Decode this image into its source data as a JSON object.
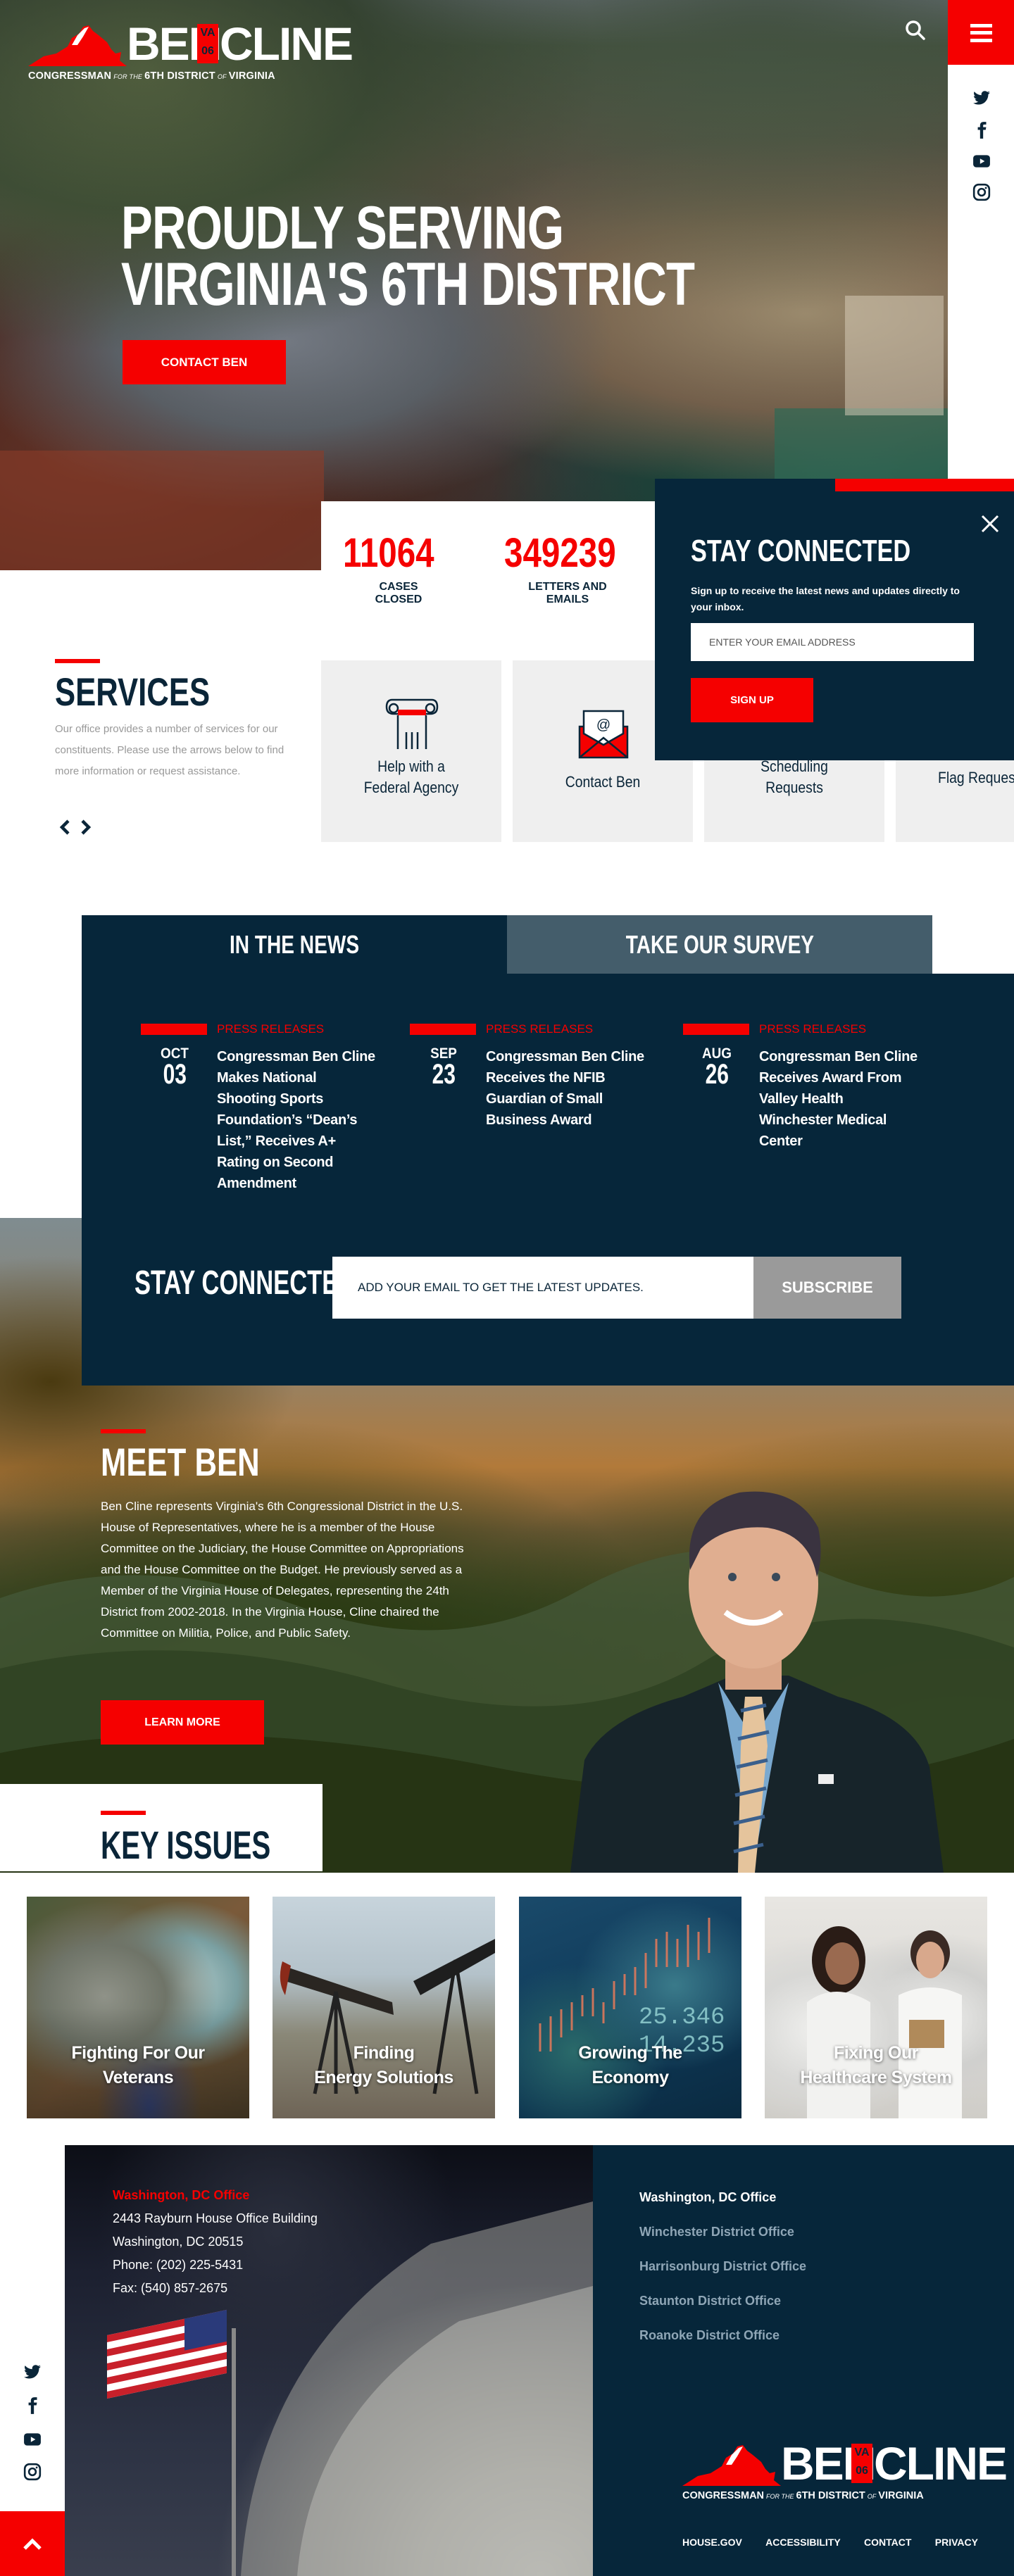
{
  "brand": {
    "first_name": "BEN",
    "badge_top": "VA",
    "badge_bottom": "06",
    "last_name": "CLINE",
    "tagline_1": "CONGRESSMAN",
    "tagline_2": "FOR THE",
    "tagline_3": "6TH DISTRICT",
    "tagline_4": "OF",
    "tagline_5": "VIRGINIA",
    "colors": {
      "red": "#f50000",
      "navy": "#06263a",
      "slate": "#445d6b",
      "grey": "#9a9a9a"
    }
  },
  "header": {
    "search_icon": "search-icon",
    "menu_icon": "hamburger-menu-icon",
    "social": [
      "twitter-icon",
      "facebook-icon",
      "youtube-icon",
      "instagram-icon"
    ]
  },
  "hero": {
    "title_line1": "PROUDLY SERVING",
    "title_line2": "VIRGINIA'S 6TH DISTRICT",
    "cta": "CONTACT BEN"
  },
  "stats": [
    {
      "value": "11064",
      "label_line1": "CASES",
      "label_line2": "CLOSED"
    },
    {
      "value": "349239",
      "label_line1": "LETTERS AND",
      "label_line2": "EMAILS"
    }
  ],
  "popup": {
    "title": "STAY CONNECTED",
    "text": "Sign up to receive the latest news and updates directly to your inbox.",
    "email_placeholder": "ENTER YOUR EMAIL ADDRESS",
    "button": "SIGN UP",
    "close_icon": "close-icon"
  },
  "services": {
    "title": "SERVICES",
    "description": "Our office provides a number of services for our constituents. Please use the arrows below to find more information or request assistance.",
    "items": [
      {
        "label_line1": "Help with a",
        "label_line2": "Federal Agency",
        "icon": "column-icon"
      },
      {
        "label_line1": "Contact Ben",
        "label_line2": "",
        "icon": "email-envelope-icon"
      },
      {
        "label_line1": "Scheduling",
        "label_line2": "Requests",
        "icon": "calendar-icon"
      },
      {
        "label_line1": "Flag Requests",
        "label_line2": "",
        "icon": "flag-icon"
      }
    ]
  },
  "news": {
    "tabs": [
      {
        "label": "IN THE NEWS",
        "active": true
      },
      {
        "label": "TAKE OUR SURVEY",
        "active": false
      }
    ],
    "articles": [
      {
        "category": "PRESS RELEASES",
        "month": "OCT",
        "day": "03",
        "title": "Congressman Ben Cline Makes National Shooting Sports Foundation’s “Dean’s List,” Receives A+ Rating on Second Amendment"
      },
      {
        "category": "PRESS RELEASES",
        "month": "SEP",
        "day": "23",
        "title": "Congressman Ben Cline Receives the NFIB Guardian of Small Business Award"
      },
      {
        "category": "PRESS RELEASES",
        "month": "AUG",
        "day": "26",
        "title": "Congressman Ben Cline Receives Award From Valley Health Winchester Medical Center"
      }
    ],
    "subscribe": {
      "title": "STAY CONNECTED",
      "placeholder": "ADD YOUR EMAIL TO GET THE LATEST UPDATES.",
      "button": "SUBSCRIBE"
    }
  },
  "meet": {
    "title": "MEET BEN",
    "bio": "Ben Cline represents Virginia's 6th Congressional District in the U.S. House of Representatives, where he is a member of the House Committee on the Judiciary, the House Committee on Appropriations and the House Committee on the Budget. He previously served as a Member of the Virginia House of Delegates, representing the 24th District from 2002-2018. In the Virginia House, Cline chaired the Committee on Militia, Police, and Public Safety.",
    "button": "LEARN MORE"
  },
  "key_issues": {
    "title": "KEY ISSUES",
    "items": [
      {
        "line1": "Fighting For Our",
        "line2": "Veterans"
      },
      {
        "line1": "Finding",
        "line2": "Energy Solutions"
      },
      {
        "line1": "Growing The",
        "line2": "Economy"
      },
      {
        "line1": "Fixing Our",
        "line2": "Healthcare System"
      }
    ]
  },
  "footer": {
    "office": {
      "heading": "Washington, DC Office",
      "address1": "2443 Rayburn House Office Building",
      "address2": "Washington, DC 20515",
      "phone": "Phone: (202) 225-5431",
      "fax": "Fax: (540) 857-2675"
    },
    "offices": [
      {
        "label": "Washington, DC Office",
        "active": true
      },
      {
        "label": "Winchester District Office",
        "active": false
      },
      {
        "label": "Harrisonburg District Office",
        "active": false
      },
      {
        "label": "Staunton District Office",
        "active": false
      },
      {
        "label": "Roanoke District Office",
        "active": false
      }
    ],
    "links": [
      "HOUSE.GOV",
      "ACCESSIBILITY",
      "CONTACT",
      "PRIVACY"
    ],
    "back_to_top_icon": "chevron-up-icon"
  }
}
